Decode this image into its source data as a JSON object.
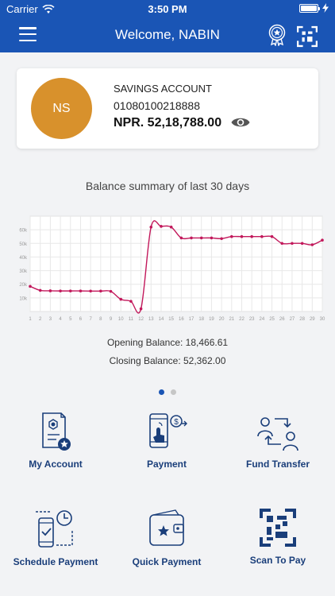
{
  "status_bar": {
    "carrier": "Carrier",
    "time": "3:50 PM"
  },
  "header": {
    "title": "Welcome, NABIN"
  },
  "account": {
    "initials": "NS",
    "type": "SAVINGS ACCOUNT",
    "number": "01080100218888",
    "balance": "NPR. 52,18,788.00"
  },
  "summary": {
    "title": "Balance summary of last 30 days",
    "opening": "Opening Balance: 18,466.61",
    "closing": "Closing Balance: 52,362.00"
  },
  "chart_data": {
    "type": "line",
    "x": [
      1,
      2,
      3,
      4,
      5,
      6,
      7,
      8,
      9,
      10,
      11,
      12,
      13,
      14,
      15,
      16,
      17,
      18,
      19,
      20,
      21,
      22,
      23,
      24,
      25,
      26,
      27,
      28,
      29,
      30
    ],
    "series": [
      {
        "values": [
          18466,
          15500,
          15200,
          15100,
          15100,
          15100,
          15000,
          15000,
          14800,
          9000,
          7500,
          2000,
          62000,
          62500,
          62000,
          54000,
          54000,
          54000,
          54000,
          53500,
          55000,
          55000,
          55000,
          55000,
          55000,
          50000,
          50000,
          50000,
          49000,
          52362
        ],
        "color": "#c2185b"
      }
    ],
    "x_ticks": [
      "1",
      "2",
      "3",
      "4",
      "5",
      "6",
      "7",
      "8",
      "9",
      "10",
      "11",
      "12",
      "13",
      "14",
      "15",
      "16",
      "17",
      "18",
      "19",
      "20",
      "21",
      "22",
      "23",
      "24",
      "25",
      "26",
      "27",
      "28",
      "29",
      "30"
    ],
    "y_ticks": [
      10000,
      20000,
      30000,
      40000,
      50000,
      60000
    ],
    "y_tick_labels": [
      "10k",
      "20k",
      "30k",
      "40k",
      "50k",
      "60k"
    ],
    "ylim": [
      0,
      70000
    ],
    "xlim": [
      1,
      30
    ],
    "grid": true
  },
  "pager": {
    "count": 2,
    "active": 0
  },
  "tiles": [
    {
      "label": "My Account",
      "icon": "my-account-icon"
    },
    {
      "label": "Payment",
      "icon": "payment-icon"
    },
    {
      "label": "Fund Transfer",
      "icon": "fund-transfer-icon"
    },
    {
      "label": "Schedule Payment",
      "icon": "schedule-payment-icon"
    },
    {
      "label": "Quick Payment",
      "icon": "quick-payment-icon"
    },
    {
      "label": "Scan To Pay",
      "icon": "scan-to-pay-icon"
    }
  ],
  "colors": {
    "primary": "#1a55b5",
    "avatar": "#d8912c",
    "chart_line": "#c2185b",
    "icon_blue": "#1a3e7a"
  }
}
